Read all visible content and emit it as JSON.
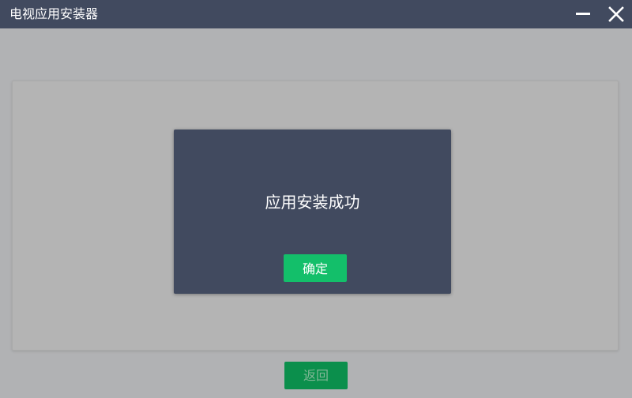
{
  "window": {
    "title": "电视应用安装器",
    "minimize_icon": "minimize-icon",
    "close_icon": "close-icon"
  },
  "dialog": {
    "message": "应用安装成功",
    "confirm_label": "确定"
  },
  "footer": {
    "back_label": "返回"
  },
  "colors": {
    "titlebar": "#414a5f",
    "background": "#b1b2b4",
    "panel": "#b4b4b4",
    "dialog": "#414a5f",
    "confirm_button": "#13bf6a",
    "back_button": "#0b8f4c"
  }
}
